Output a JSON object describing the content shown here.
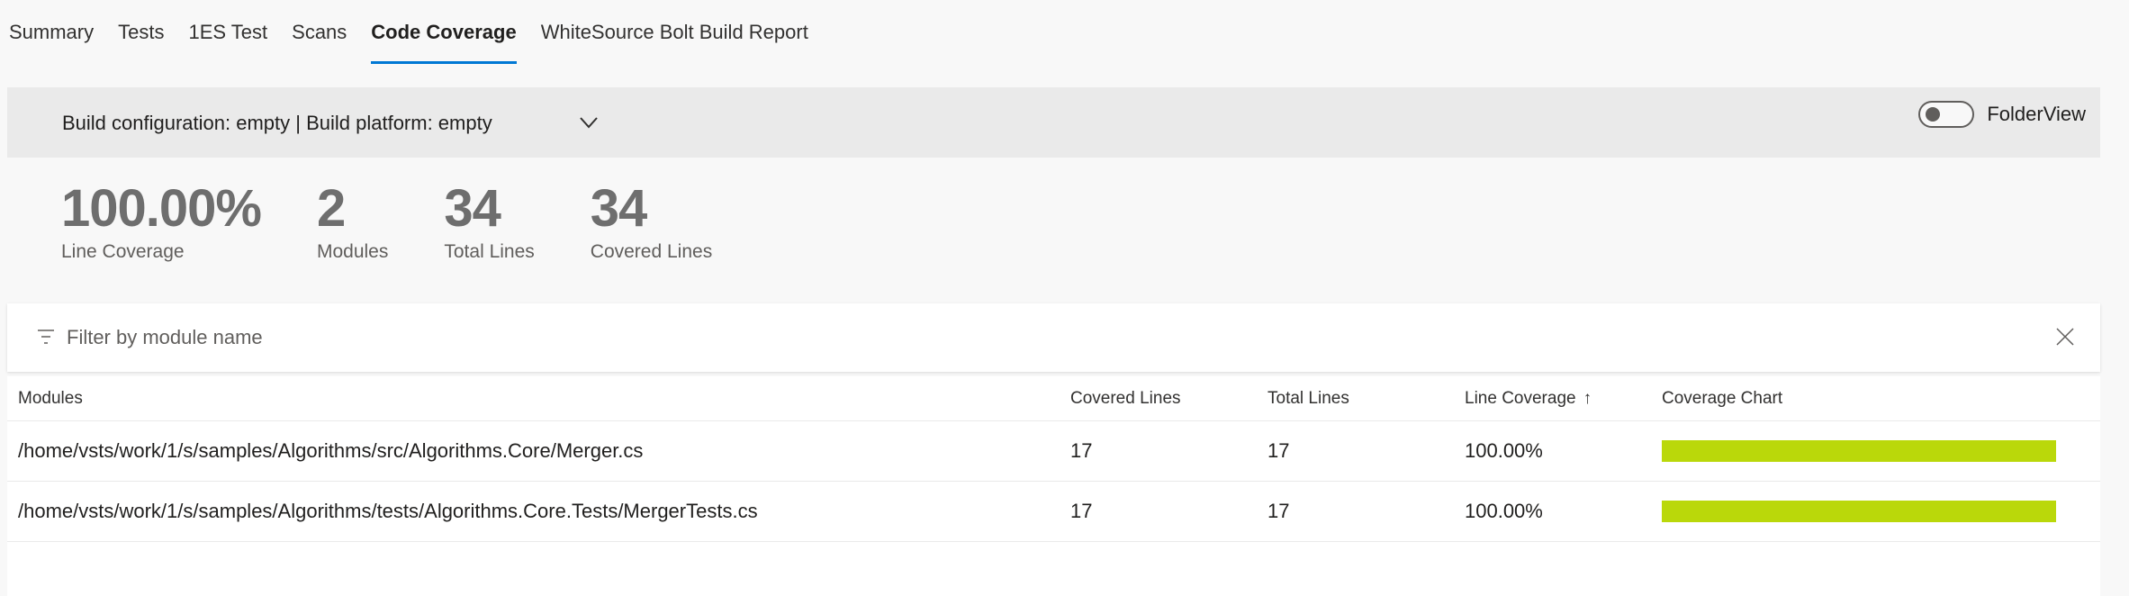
{
  "tabs": [
    {
      "label": "Summary",
      "selected": false
    },
    {
      "label": "Tests",
      "selected": false
    },
    {
      "label": "1ES Test",
      "selected": false
    },
    {
      "label": "Scans",
      "selected": false
    },
    {
      "label": "Code Coverage",
      "selected": true
    },
    {
      "label": "WhiteSource Bolt Build Report",
      "selected": false
    }
  ],
  "config": {
    "label": "Build configuration: empty | Build platform: empty",
    "toggle_label": "FolderView",
    "toggle_on": false
  },
  "stats": [
    {
      "value": "100.00%",
      "label": "Line Coverage"
    },
    {
      "value": "2",
      "label": "Modules"
    },
    {
      "value": "34",
      "label": "Total Lines"
    },
    {
      "value": "34",
      "label": "Covered Lines"
    }
  ],
  "filter": {
    "placeholder": "Filter by module name",
    "value": ""
  },
  "table": {
    "columns": [
      "Modules",
      "Covered Lines",
      "Total Lines",
      "Line Coverage",
      "Coverage Chart"
    ],
    "sort_indicator": "↑",
    "rows": [
      {
        "module": "/home/vsts/work/1/s/samples/Algorithms/src/Algorithms.Core/Merger.cs",
        "covered": "17",
        "total": "17",
        "coverage": "100.00%",
        "coverage_fraction": 1.0
      },
      {
        "module": "/home/vsts/work/1/s/samples/Algorithms/tests/Algorithms.Core.Tests/MergerTests.cs",
        "covered": "17",
        "total": "17",
        "coverage": "100.00%",
        "coverage_fraction": 1.0
      }
    ]
  },
  "colors": {
    "accent": "#0078d4",
    "coverage_bar": "#bad80a"
  }
}
